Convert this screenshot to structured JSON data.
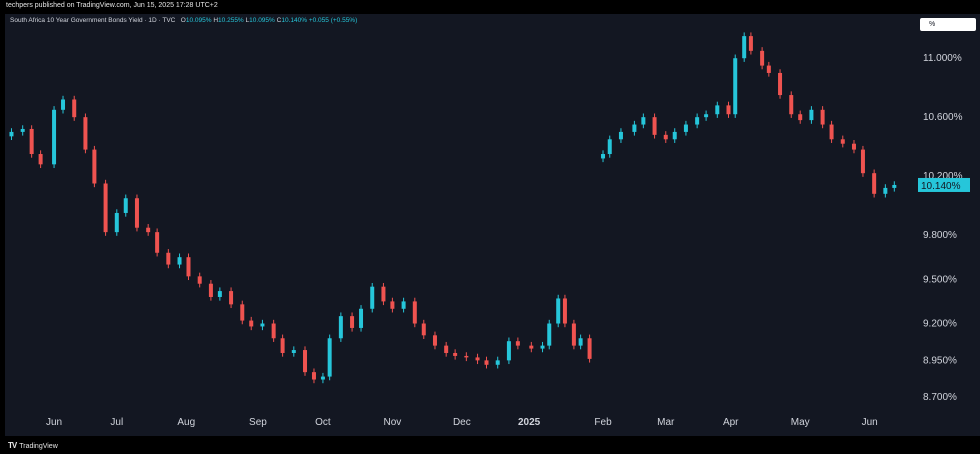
{
  "header": {
    "publisher": "techpers published on TradingView.com, Jun 15, 2025 17:28 UTC+2"
  },
  "legend": {
    "title": "South Africa 10 Year Government Bonds Yield · 1D · TVC",
    "o_key": "O",
    "o_val": "10.095%",
    "h_key": "H",
    "h_val": "10.255%",
    "l_key": "L",
    "l_val": "10.095%",
    "c_key": "C",
    "c_val": "10.140%",
    "change": "+0.055 (+0.55%)"
  },
  "unit_label": "%",
  "footer": {
    "brand": "TradingView"
  },
  "colors": {
    "up": "#26c6da",
    "down": "#ef5350",
    "background": "#131722",
    "price_label": "#26c6da"
  },
  "chart_data": {
    "type": "candlestick",
    "y_axis": {
      "position": "right",
      "ylim": [
        8.62,
        11.3
      ],
      "ticks": [
        11.0,
        10.6,
        10.2,
        9.8,
        9.5,
        9.2,
        8.95,
        8.7
      ],
      "tick_labels": [
        "11.000%",
        "10.600%",
        "10.200%",
        "9.800%",
        "9.500%",
        "9.200%",
        "8.950%",
        "8.700%"
      ]
    },
    "x_axis": {
      "start": "2024-05-13",
      "end": "2025-06-20",
      "labels": [
        {
          "text": "Jun",
          "date": "2024-06-03"
        },
        {
          "text": "Jul",
          "date": "2024-07-01"
        },
        {
          "text": "Aug",
          "date": "2024-08-01"
        },
        {
          "text": "Sep",
          "date": "2024-09-02"
        },
        {
          "text": "Oct",
          "date": "2024-10-01"
        },
        {
          "text": "Nov",
          "date": "2024-11-01"
        },
        {
          "text": "Dec",
          "date": "2024-12-02"
        },
        {
          "text": "2025",
          "date": "2025-01-01",
          "bold": true
        },
        {
          "text": "Feb",
          "date": "2025-02-03"
        },
        {
          "text": "Mar",
          "date": "2025-03-03"
        },
        {
          "text": "Apr",
          "date": "2025-04-01"
        },
        {
          "text": "May",
          "date": "2025-05-02"
        },
        {
          "text": "Jun",
          "date": "2025-06-02"
        }
      ]
    },
    "last_price": {
      "value": 10.14,
      "label": "10.140%"
    },
    "series": [
      {
        "date": "2024-05-15",
        "close": 10.5
      },
      {
        "date": "2024-05-20",
        "close": 10.52
      },
      {
        "date": "2024-05-24",
        "close": 10.35
      },
      {
        "date": "2024-05-28",
        "close": 10.28
      },
      {
        "date": "2024-06-03",
        "close": 10.65
      },
      {
        "date": "2024-06-07",
        "close": 10.72
      },
      {
        "date": "2024-06-12",
        "close": 10.6
      },
      {
        "date": "2024-06-17",
        "close": 10.38
      },
      {
        "date": "2024-06-21",
        "close": 10.15
      },
      {
        "date": "2024-06-26",
        "close": 9.82
      },
      {
        "date": "2024-07-01",
        "close": 9.95
      },
      {
        "date": "2024-07-05",
        "close": 10.05
      },
      {
        "date": "2024-07-10",
        "close": 9.85
      },
      {
        "date": "2024-07-15",
        "close": 9.82
      },
      {
        "date": "2024-07-19",
        "close": 9.68
      },
      {
        "date": "2024-07-24",
        "close": 9.6
      },
      {
        "date": "2024-07-29",
        "close": 9.65
      },
      {
        "date": "2024-08-02",
        "close": 9.52
      },
      {
        "date": "2024-08-07",
        "close": 9.47
      },
      {
        "date": "2024-08-12",
        "close": 9.38
      },
      {
        "date": "2024-08-16",
        "close": 9.42
      },
      {
        "date": "2024-08-21",
        "close": 9.33
      },
      {
        "date": "2024-08-26",
        "close": 9.22
      },
      {
        "date": "2024-08-30",
        "close": 9.18
      },
      {
        "date": "2024-09-04",
        "close": 9.2
      },
      {
        "date": "2024-09-09",
        "close": 9.1
      },
      {
        "date": "2024-09-13",
        "close": 9.0
      },
      {
        "date": "2024-09-18",
        "close": 9.02
      },
      {
        "date": "2024-09-23",
        "close": 8.87
      },
      {
        "date": "2024-09-27",
        "close": 8.82
      },
      {
        "date": "2024-10-01",
        "close": 8.84
      },
      {
        "date": "2024-10-04",
        "close": 9.1
      },
      {
        "date": "2024-10-09",
        "close": 9.25
      },
      {
        "date": "2024-10-14",
        "close": 9.17
      },
      {
        "date": "2024-10-18",
        "close": 9.3
      },
      {
        "date": "2024-10-23",
        "close": 9.45
      },
      {
        "date": "2024-10-28",
        "close": 9.35
      },
      {
        "date": "2024-11-01",
        "close": 9.3
      },
      {
        "date": "2024-11-06",
        "close": 9.35
      },
      {
        "date": "2024-11-11",
        "close": 9.2
      },
      {
        "date": "2024-11-15",
        "close": 9.12
      },
      {
        "date": "2024-11-20",
        "close": 9.05
      },
      {
        "date": "2024-11-25",
        "close": 9.0
      },
      {
        "date": "2024-11-29",
        "close": 8.98
      },
      {
        "date": "2024-12-04",
        "close": 8.97
      },
      {
        "date": "2024-12-09",
        "close": 8.95
      },
      {
        "date": "2024-12-13",
        "close": 8.92
      },
      {
        "date": "2024-12-18",
        "close": 8.95
      },
      {
        "date": "2024-12-23",
        "close": 9.08
      },
      {
        "date": "2024-12-27",
        "close": 9.05
      },
      {
        "date": "2025-01-02",
        "close": 9.03
      },
      {
        "date": "2025-01-07",
        "close": 9.05
      },
      {
        "date": "2025-01-10",
        "close": 9.2
      },
      {
        "date": "2025-01-14",
        "close": 9.37
      },
      {
        "date": "2025-01-17",
        "close": 9.2
      },
      {
        "date": "2025-01-21",
        "close": 9.05
      },
      {
        "date": "2025-01-24",
        "close": 9.1
      },
      {
        "date": "2025-01-28",
        "close": 8.96
      },
      {
        "date": "2025-02-03",
        "close": 10.35
      },
      {
        "date": "2025-02-06",
        "close": 10.45
      },
      {
        "date": "2025-02-11",
        "close": 10.5
      },
      {
        "date": "2025-02-17",
        "close": 10.55
      },
      {
        "date": "2025-02-21",
        "close": 10.6
      },
      {
        "date": "2025-02-26",
        "close": 10.48
      },
      {
        "date": "2025-03-03",
        "close": 10.45
      },
      {
        "date": "2025-03-07",
        "close": 10.5
      },
      {
        "date": "2025-03-12",
        "close": 10.55
      },
      {
        "date": "2025-03-17",
        "close": 10.6
      },
      {
        "date": "2025-03-21",
        "close": 10.62
      },
      {
        "date": "2025-03-26",
        "close": 10.68
      },
      {
        "date": "2025-03-31",
        "close": 10.62
      },
      {
        "date": "2025-04-03",
        "close": 11.0
      },
      {
        "date": "2025-04-07",
        "close": 11.15
      },
      {
        "date": "2025-04-10",
        "close": 11.05
      },
      {
        "date": "2025-04-15",
        "close": 10.95
      },
      {
        "date": "2025-04-18",
        "close": 10.9
      },
      {
        "date": "2025-04-23",
        "close": 10.75
      },
      {
        "date": "2025-04-28",
        "close": 10.62
      },
      {
        "date": "2025-05-02",
        "close": 10.58
      },
      {
        "date": "2025-05-07",
        "close": 10.65
      },
      {
        "date": "2025-05-12",
        "close": 10.55
      },
      {
        "date": "2025-05-16",
        "close": 10.45
      },
      {
        "date": "2025-05-21",
        "close": 10.42
      },
      {
        "date": "2025-05-26",
        "close": 10.38
      },
      {
        "date": "2025-05-30",
        "close": 10.22
      },
      {
        "date": "2025-06-04",
        "close": 10.08
      },
      {
        "date": "2025-06-09",
        "close": 10.12
      },
      {
        "date": "2025-06-13",
        "close": 10.14
      }
    ]
  }
}
